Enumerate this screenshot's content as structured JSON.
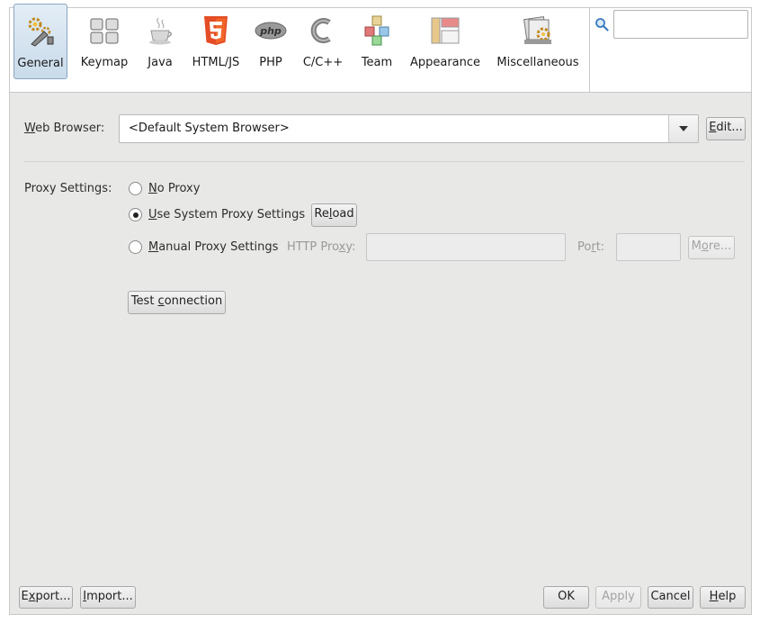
{
  "toolbar": {
    "categories": [
      {
        "label": "General",
        "icon": "general-icon",
        "selected": true
      },
      {
        "label": "Keymap",
        "icon": "keymap-icon"
      },
      {
        "label": "Java",
        "icon": "java-icon"
      },
      {
        "label": "HTML/JS",
        "icon": "html5-icon"
      },
      {
        "label": "PHP",
        "icon": "php-icon"
      },
      {
        "label": "C/C++",
        "icon": "cpp-icon"
      },
      {
        "label": "Team",
        "icon": "team-icon"
      },
      {
        "label": "Appearance",
        "icon": "appearance-icon"
      },
      {
        "label": "Miscellaneous",
        "icon": "miscellaneous-icon"
      }
    ]
  },
  "search": {
    "icon": "search-icon",
    "value": ""
  },
  "browser": {
    "label_accel": "W",
    "label_rest": "eb Browser:",
    "selected_value": "<Default System Browser>",
    "edit_accel": "E",
    "edit_rest": "dit..."
  },
  "proxy": {
    "label": "Proxy Settings:",
    "no_proxy_accel": "N",
    "no_proxy_rest": "o Proxy",
    "system_accel": "U",
    "system_rest": "se System Proxy Settings",
    "reload_pre": "Re",
    "reload_accel": "l",
    "reload_post": "oad",
    "manual_accel": "M",
    "manual_rest": "anual Proxy Settings",
    "http_label_pre": "HTTP Pro",
    "http_label_accel": "x",
    "http_label_post": "y:",
    "http_value": "",
    "port_label_pre": "Po",
    "port_label_accel": "r",
    "port_label_post": "t:",
    "port_value": "",
    "more_pre": "M",
    "more_accel": "o",
    "more_post": "re...",
    "selected": "system",
    "test_pre": "Test ",
    "test_accel": "c",
    "test_post": "onnection"
  },
  "footer": {
    "export_pre": "E",
    "export_accel": "x",
    "export_post": "port...",
    "import_accel": "I",
    "import_rest": "mport...",
    "ok": "OK",
    "apply": "Apply",
    "cancel": "Cancel",
    "help_accel": "H",
    "help_rest": "elp"
  },
  "colors": {
    "panel_bg": "#e8e8e7",
    "selected_tab": "#c9dbea",
    "html5_orange": "#e44d26"
  }
}
